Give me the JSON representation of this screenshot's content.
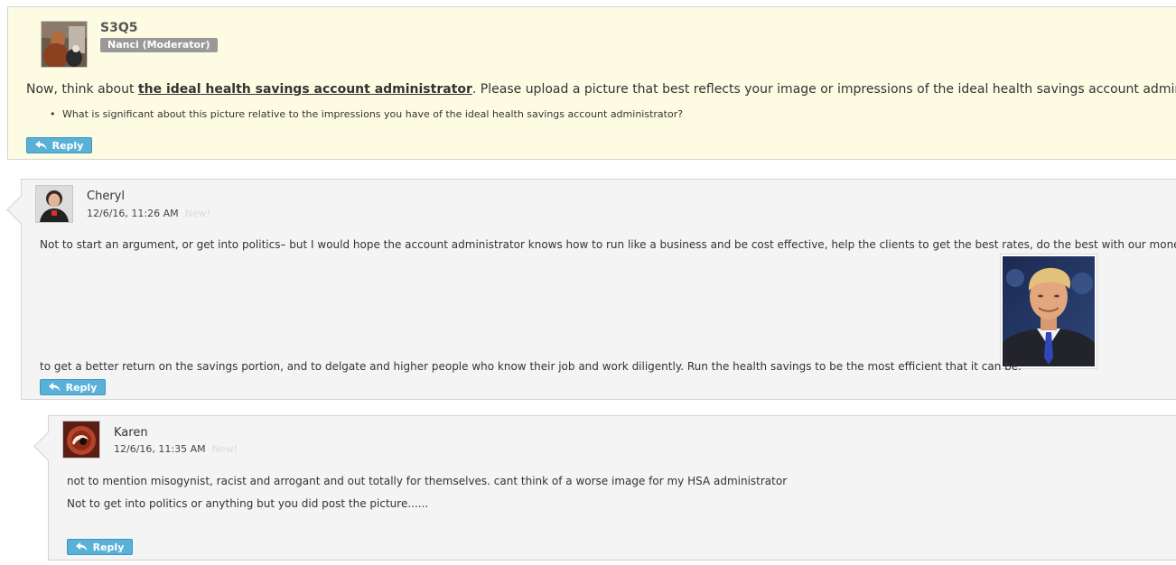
{
  "question": {
    "title": "S3Q5",
    "badge": "Nanci (Moderator)",
    "lead_before": "Now, think about ",
    "lead_link": "the ideal health savings account administrator",
    "lead_after": ".  Please upload a picture that best reflects your image or impressions of the ideal health savings account administrator.",
    "bullet": "What is significant about this picture relative to the impressions you have of the ideal health savings account administrator?",
    "reply_label": "Reply"
  },
  "replies": [
    {
      "author": "Cheryl",
      "timestamp": "12/6/16, 11:26 AM",
      "new_label": "New!",
      "line1": "Not to start an argument, or get into politics– but I would hope the account administrator knows how to run like a business and be cost effective, help the clients to get the best rates, do the best with our money",
      "line2": "to get a better return on the savings portion, and to delgate and higher people who know their job and work diligently.  Run the health savings to be the most efficient that it can be.",
      "reply_label": "Reply"
    },
    {
      "author": "Karen",
      "timestamp": "12/6/16, 11:35 AM",
      "new_label": "New!",
      "line1": "not to mention misogynist, racist and arrogant and out totally for themselves.   cant think of a worse image for my HSA administrator",
      "line2": "Not to get into politics or anything but you did post the picture......",
      "reply_label": "Reply"
    }
  ],
  "colors": {
    "reply_button": "#5ab1d8",
    "question_bg": "#fdfce3",
    "reply_bg": "#f4f4f4",
    "badge": "#999999"
  },
  "icons": [
    "reply-arrow-icon"
  ]
}
